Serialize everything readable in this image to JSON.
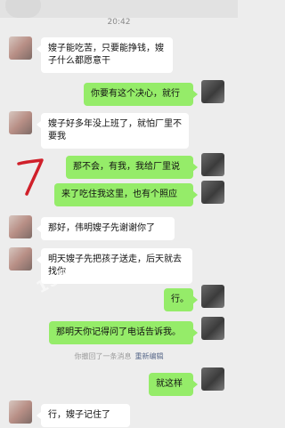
{
  "header": {
    "timestamp": "20:42"
  },
  "messages": [
    {
      "side": "left",
      "text": "嫂子能吃苦，只要能挣钱，嫂子什么都愿意干"
    },
    {
      "side": "right",
      "text": "你要有这个决心，就行"
    },
    {
      "side": "left",
      "text": "嫂子好多年没上班了，就怕厂里不要我"
    },
    {
      "side": "right",
      "text": "那不会，有我，我给厂里说"
    },
    {
      "side": "right",
      "text": "来了吃住我这里，也有个照应"
    },
    {
      "side": "left",
      "text": "那好，伟明嫂子先谢谢你了"
    },
    {
      "side": "left",
      "text": "明天嫂子先把孩子送走，后天就去找你"
    },
    {
      "side": "right",
      "text": "行。"
    },
    {
      "side": "right",
      "text": "那明天你记得问了电话告诉我。"
    },
    {
      "side": "right",
      "text": "就这样"
    },
    {
      "side": "left",
      "text": "行，嫂子记住了"
    }
  ],
  "recall_notice": {
    "text": "你撤回了一条消息",
    "edit_label": "重新编辑"
  },
  "colors": {
    "background": "#ededed",
    "sent_bubble": "#95ec69",
    "received_bubble": "#ffffff",
    "annotation": "#d0202a"
  }
}
